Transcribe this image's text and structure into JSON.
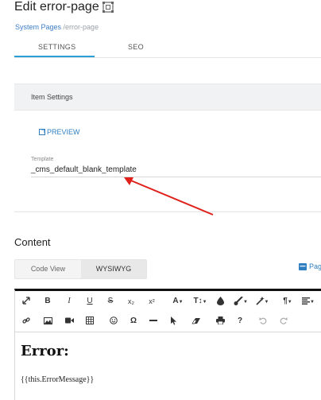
{
  "header": {
    "title": "Edit error-page",
    "breadcrumb_link": "System Pages",
    "breadcrumb_current": "/error-page"
  },
  "tabs": [
    {
      "label": "SETTINGS",
      "active": true
    },
    {
      "label": "SEO",
      "active": false
    }
  ],
  "item_settings": {
    "title": "Item Settings",
    "preview_label": "PREVIEW",
    "template_label": "Template",
    "template_value": "_cms_default_blank_template"
  },
  "content": {
    "heading": "Content",
    "view_code": "Code View",
    "view_wysiwyg": "WYSIWYG",
    "page_link": "Pag"
  },
  "toolbar": {
    "bold": "B",
    "italic": "I",
    "underline": "U",
    "strike": "S",
    "subscript": "x₂",
    "superscript": "x²",
    "font_color": "A",
    "font_size": "T↕",
    "paragraph": "¶",
    "omega": "Ω",
    "help": "?"
  },
  "editor": {
    "heading": "Error:",
    "body": "{{this.ErrorMessage}}"
  },
  "colors": {
    "accent": "#2a9fd6",
    "link": "#2f7fc1",
    "annotation_arrow": "#e0201b"
  }
}
